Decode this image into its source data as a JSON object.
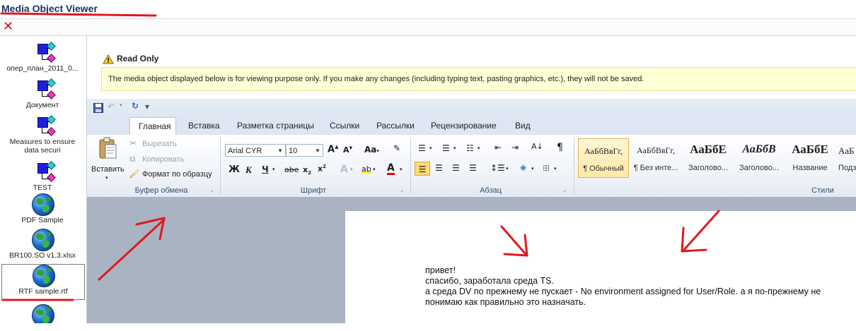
{
  "window": {
    "title": "Media Object Viewer"
  },
  "left_panel": {
    "items": [
      {
        "label": "опер_план_2011_0...",
        "icon": "document-icon"
      },
      {
        "label": "Документ",
        "icon": "document-icon"
      },
      {
        "label": "Measures to ensure data securi",
        "icon": "document-icon"
      },
      {
        "label": "TEST",
        "icon": "document-icon"
      },
      {
        "label": "PDF Sample",
        "icon": "globe-icon"
      },
      {
        "label": "BR100.SO v1.3.xlsx",
        "icon": "globe-icon"
      },
      {
        "label": "RTF sample.rtf",
        "icon": "globe-icon",
        "selected": true
      }
    ]
  },
  "notice": {
    "title": "Read Only",
    "message": "The media object displayed below is for viewing purpose only. If you make any changes (including typing text, pasting graphics, etc.), they will not be saved."
  },
  "ribbon": {
    "tabs": [
      {
        "label": "Главная",
        "active": true
      },
      {
        "label": "Вставка"
      },
      {
        "label": "Разметка страницы"
      },
      {
        "label": "Ссылки"
      },
      {
        "label": "Рассылки"
      },
      {
        "label": "Рецензирование"
      },
      {
        "label": "Вид"
      }
    ],
    "clipboard": {
      "paste": "Вставить",
      "cut": "Вырезать",
      "copy": "Копировать",
      "format_painter": "Формат по образцу",
      "label": "Буфер обмена"
    },
    "font": {
      "name": "Arial CYR",
      "size": "10",
      "label": "Шрифт",
      "bold": "Ж",
      "italic": "К",
      "underline": "Ч",
      "change_case": "Aa"
    },
    "paragraph": {
      "label": "Абзац"
    },
    "styles": {
      "label": "Стили",
      "items": [
        {
          "sample": "АаБбВвГг,",
          "name": "¶ Обычный",
          "active": true
        },
        {
          "sample": "АаБбВвГг,",
          "name": "¶ Без инте..."
        },
        {
          "sample": "АаБбЕ",
          "name": "Заголово..."
        },
        {
          "sample": "АаБбВ",
          "name": "Заголово..."
        },
        {
          "sample": "АаБбЕ",
          "name": "Название"
        },
        {
          "sample": "АаБ",
          "name": "Подз"
        }
      ]
    }
  },
  "document": {
    "lines": [
      "привет!",
      "спасибо, заработала среда TS.",
      "а среда DV по прежнему не пускает - No environment assigned for User/Role. а я по-прежнему не",
      "понимаю как правильно это назначать."
    ]
  },
  "colors": {
    "annotation": "#e0191f",
    "title": "#14326b",
    "banner": "#ffffd5"
  }
}
